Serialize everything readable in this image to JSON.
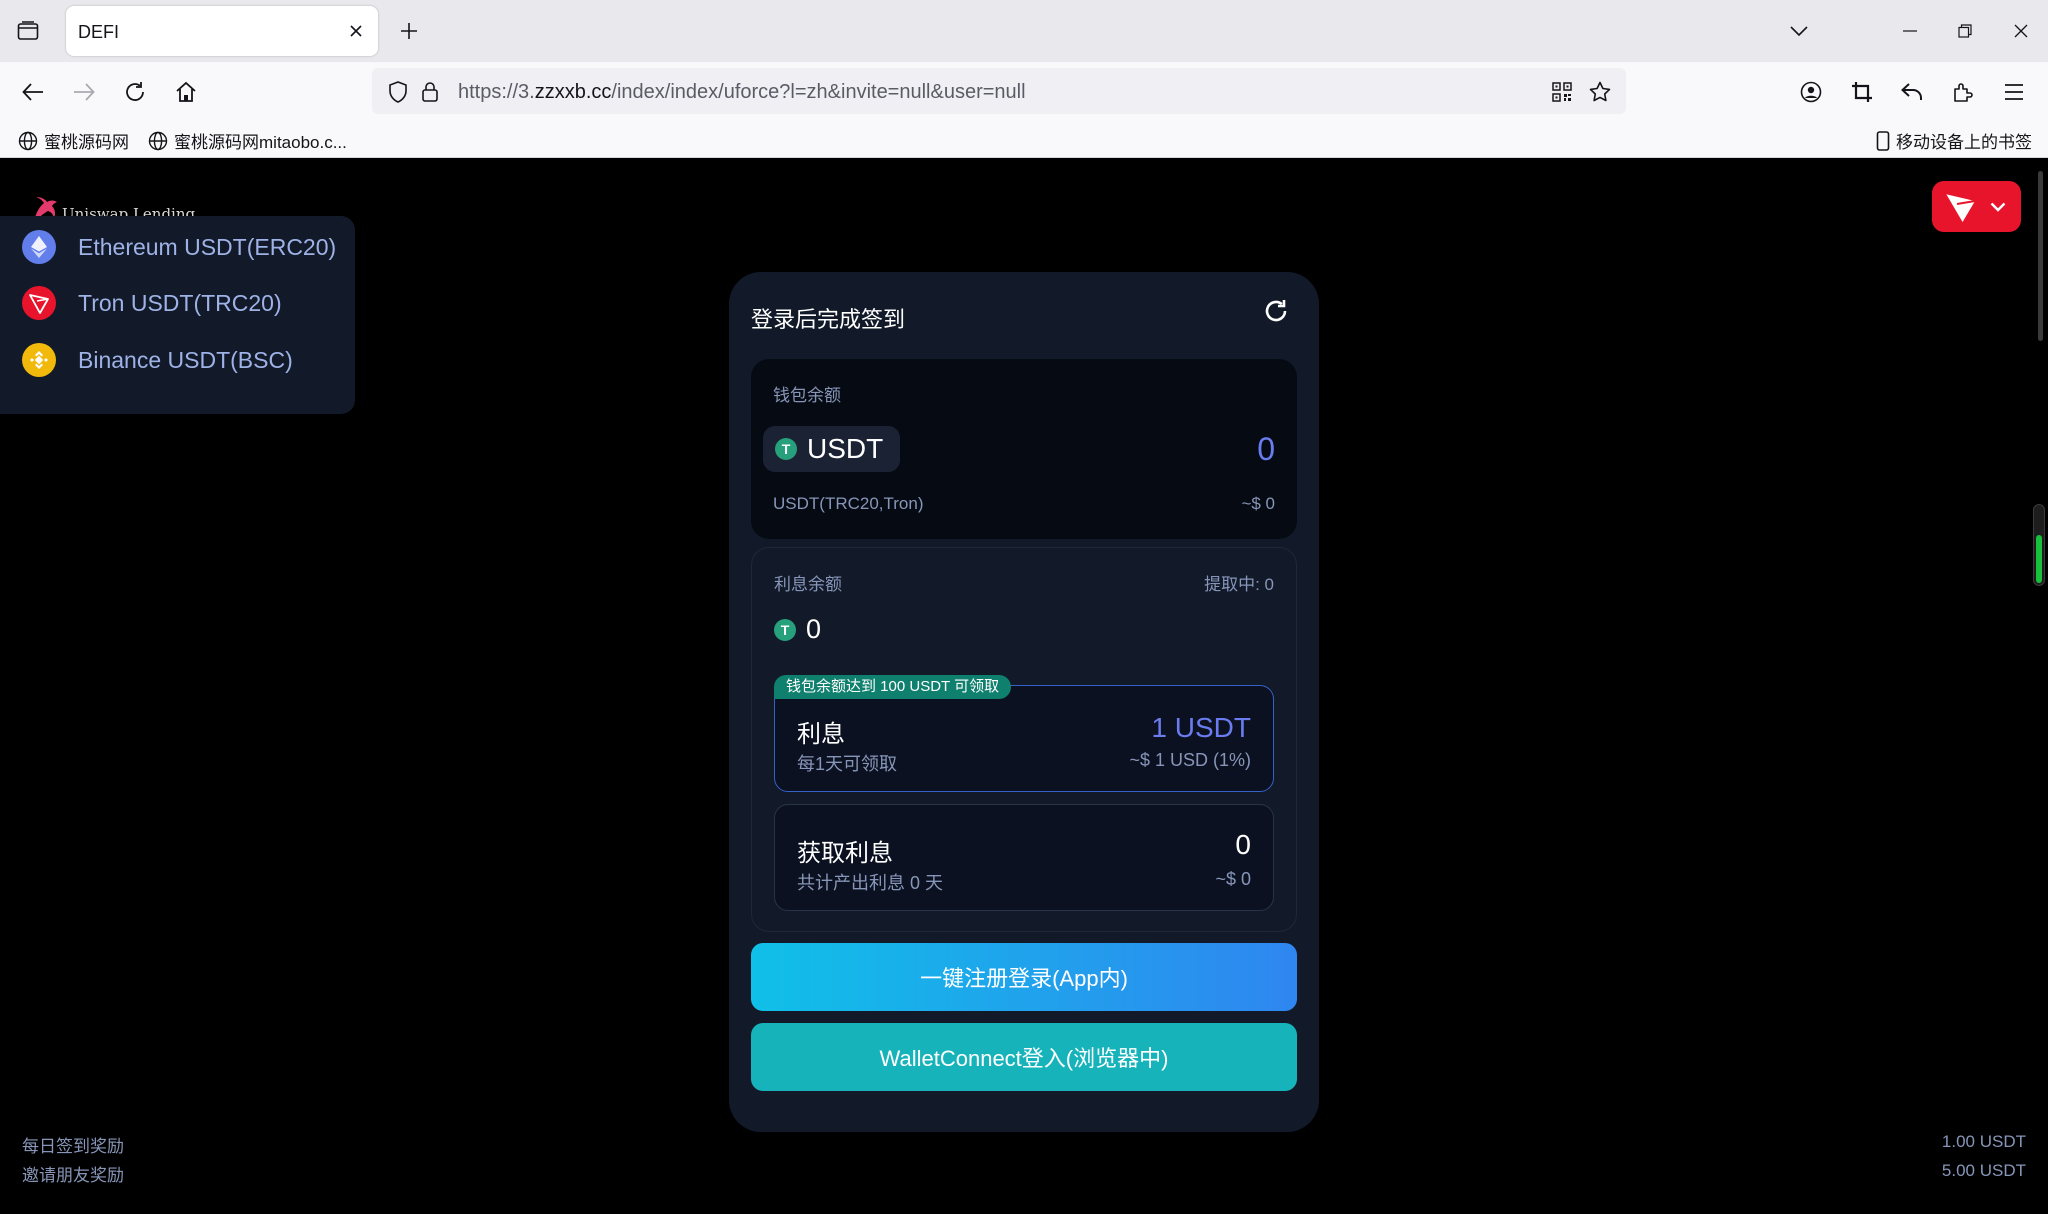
{
  "browser": {
    "tab_title": "DEFI",
    "url_prefix": "https://3.",
    "url_domain": "zzxxb.cc",
    "url_path": "/index/index/uforce?l=zh&invite=null&user=null",
    "bookmarks": [
      {
        "label": "蜜桃源码网"
      },
      {
        "label": "蜜桃源码网mitaobo.c..."
      }
    ],
    "mobile_bookmarks": "移动设备上的书签"
  },
  "page": {
    "brand": "Uniswap Lending",
    "networks": [
      {
        "label": "Ethereum USDT(ERC20)",
        "icon": "ethereum-icon",
        "color": "#627eea"
      },
      {
        "label": "Tron USDT(TRC20)",
        "icon": "tron-icon",
        "color": "#e8142c"
      },
      {
        "label": "Binance USDT(BSC)",
        "icon": "binance-icon",
        "color": "#f0b90b"
      }
    ],
    "card": {
      "title": "登录后完成签到",
      "wallet": {
        "label": "钱包余额",
        "token": "USDT",
        "value": "0",
        "network": "USDT(TRC20,Tron)",
        "usd": "~$ 0"
      },
      "interest": {
        "label": "利息余额",
        "withdrawing": "提取中: 0",
        "value": "0",
        "tier": {
          "badge": "钱包余额达到 100 USDT 可领取",
          "name": "利息",
          "sub": "每1天可领取",
          "amount": "1 USDT",
          "usd": "~$ 1 USD (1%)"
        },
        "earned": {
          "name": "获取利息",
          "sub": "共计产出利息 0 天",
          "value": "0",
          "usd": "~$ 0"
        }
      },
      "btn_app_login": "一键注册登录(App内)",
      "btn_walletconnect": "WalletConnect登入(浏览器中)"
    },
    "footer": {
      "daily_label": "每日签到奖励",
      "daily_value": "1.00 USDT",
      "invite_label": "邀请朋友奖励",
      "invite_value": "5.00 USDT"
    }
  },
  "colors": {
    "accent": "#6a7cf0",
    "card_bg": "#121a2a",
    "tron_red": "#e8142c",
    "teal": "#17b3bb",
    "tether_green": "#26a17b"
  }
}
